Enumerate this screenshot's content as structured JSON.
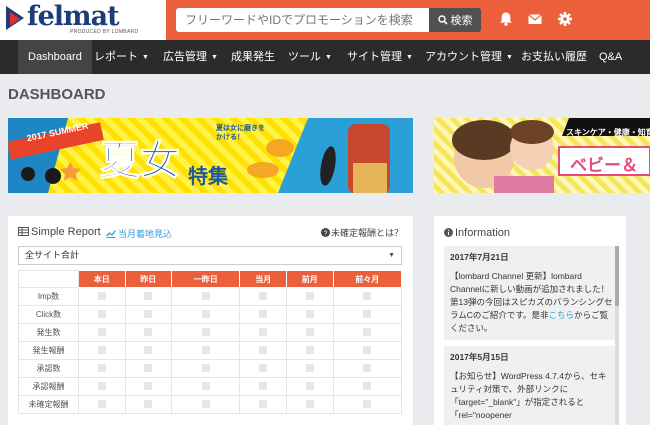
{
  "header": {
    "logo_text": "felmat",
    "logo_tagline": "PRODUCED BY LOMBARD",
    "search_placeholder": "フリーワードやIDでプロモーションを検索",
    "search_button": "検索"
  },
  "nav": [
    {
      "label": "Dashboard",
      "caret": false,
      "active": true
    },
    {
      "label": "レポート",
      "caret": true
    },
    {
      "label": "広告管理",
      "caret": true
    },
    {
      "label": "成果発生",
      "caret": false
    },
    {
      "label": "ツール",
      "caret": true
    },
    {
      "label": "サイト管理",
      "caret": true
    },
    {
      "label": "アカウント管理",
      "caret": true
    },
    {
      "label": "お支払い履歴",
      "caret": false
    },
    {
      "label": "Q&A",
      "caret": false
    }
  ],
  "page_title": "DASHBOARD",
  "banners": {
    "summer": {
      "badge": "2017 SUMMER",
      "title": "夏女",
      "subtitle": "特集",
      "bubble": "夏は女に磨きをかける！"
    },
    "beauty": {
      "category": "スキンケア・健康・知育",
      "title": "ベビー＆"
    }
  },
  "simple_report": {
    "title": "Simple Report",
    "link": "当月着地見込",
    "help": "未確定報酬とは？",
    "select_value": "全サイト合計",
    "columns": [
      "本日",
      "昨日",
      "一昨日",
      "当月",
      "前月",
      "前々月"
    ],
    "rows": [
      "Imp数",
      "Click数",
      "発生数",
      "発生報酬",
      "承認数",
      "承認報酬",
      "未確定報酬"
    ]
  },
  "information": {
    "title": "Information",
    "items": [
      {
        "date": "2017年7月21日",
        "pre": "【lombard Channel 更新】lombard Channelに新しい動画が追加されました！第13弾の今回はスピカズのバランシングセラムCのご紹介です。是非",
        "link": "こちら",
        "post": "からご覧ください。"
      },
      {
        "date": "2017年5月15日",
        "pre": "【お知らせ】WordPress 4.7.4から、セキュリティ対策で、外部リンクに「target=\"_blank\"」が指定されると「rel=\"noopener",
        "link": "",
        "post": ""
      }
    ]
  },
  "colors": {
    "accent": "#ec5f3b",
    "nav_bg": "#2b2b2b",
    "link": "#2aa0d8",
    "brand": "#1d3d7a"
  }
}
